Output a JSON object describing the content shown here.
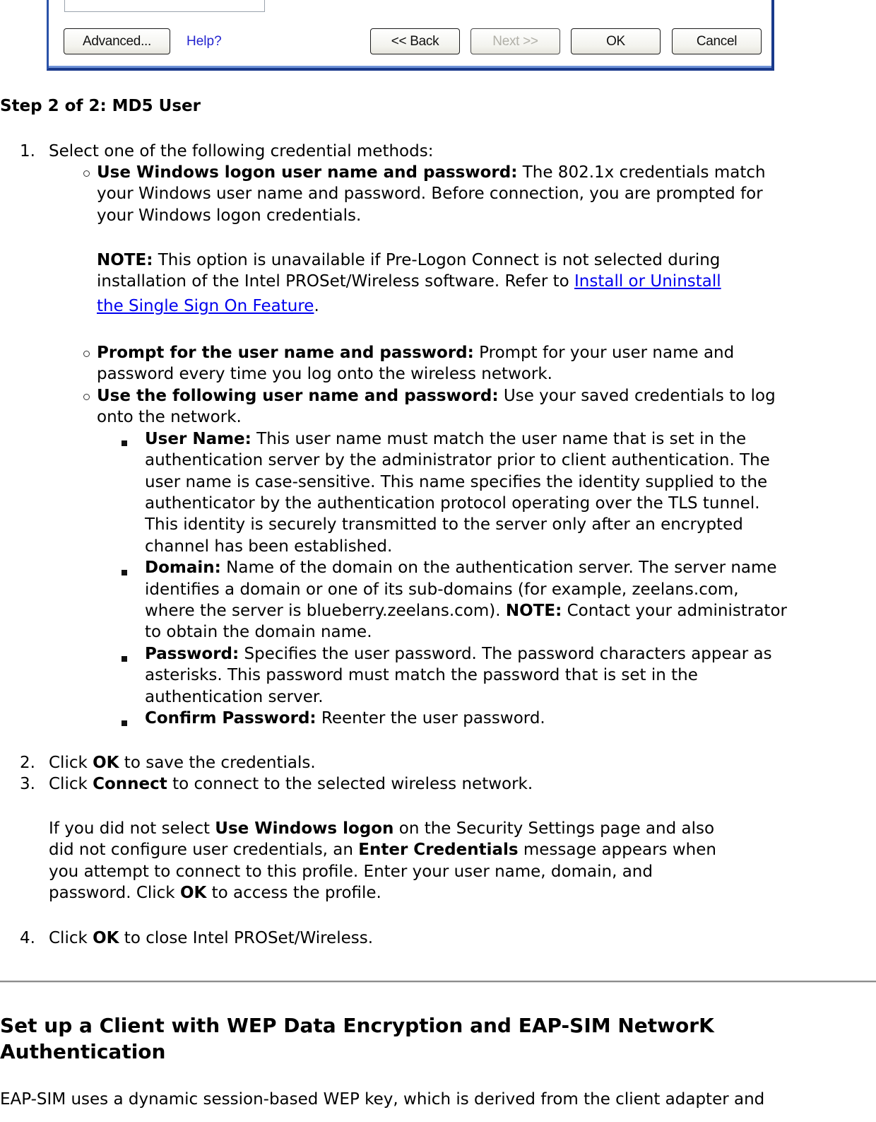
{
  "dialog": {
    "buttons": {
      "advanced": "Advanced...",
      "help": "Help?",
      "back": "<< Back",
      "next": "Next >>",
      "ok": "OK",
      "cancel": "Cancel"
    },
    "next_disabled": true
  },
  "step_heading": "Step 2 of 2: MD5 User",
  "steps": {
    "s1": {
      "number": "1.",
      "text": "Select one of the following credential methods:",
      "options": {
        "o1": {
          "label": "Use Windows logon user name and password:",
          "lines": [
            " The 802.1x credentials match",
            "your Windows user name and password. Before connection, you are prompted for",
            "your Windows logon credentials."
          ],
          "note_label": "NOTE:",
          "note_lines": [
            " This option is unavailable if Pre-Logon Connect is not selected during",
            "installation of the Intel PROSet/Wireless software. Refer to "
          ],
          "link_part1": "Install or Uninstall ",
          "link_part2": "the Single Sign On Feature",
          "link_suffix": "."
        },
        "o2": {
          "label": "Prompt for the user name and password:",
          "lines": [
            " Prompt for your user name and",
            "password every time you log onto the wireless network."
          ]
        },
        "o3": {
          "label": "Use the following user name and password:",
          "lines": [
            " Use your saved credentials to log",
            "onto the network."
          ],
          "fields": {
            "user_name": {
              "label": "User Name:",
              "lines": [
                " This user name must match the user name that is set in the",
                "authentication server by the administrator prior to client authentication. The",
                "user name is case-sensitive. This name specifies the identity supplied to the",
                "authenticator by the authentication protocol operating over the TLS tunnel.",
                "This identity is securely transmitted to the server only after an encrypted",
                "channel has been established."
              ]
            },
            "domain": {
              "label": "Domain:",
              "lines": [
                " Name of the domain on the authentication server. The server name",
                "identifies a domain or one of its sub-domains (for example, zeelans.com,",
                "where the server is blueberry.zeelans.com). ",
                "to obtain the domain name."
              ],
              "note_label": "NOTE:",
              "note_text": " Contact your administrator"
            },
            "password": {
              "label": "Password:",
              "lines": [
                " Specifies the user password. The password characters appear as",
                "asterisks. This password must match the password that is set in the",
                "authentication server."
              ]
            },
            "confirm_password": {
              "label": "Confirm Password:",
              "lines": [
                " Reenter the user password."
              ]
            }
          }
        }
      }
    },
    "s2": {
      "number": "2.",
      "pre": "Click ",
      "bold": "OK",
      "post": " to save the credentials."
    },
    "s3": {
      "number": "3.",
      "pre": "Click ",
      "bold": "Connect",
      "post": " to connect to the selected wireless network.",
      "note": {
        "l1_pre": "If you did not select ",
        "l1_bold": "Use Windows logon",
        "l1_post": " on the Security Settings page and also",
        "l2_pre": "did not configure user credentials, an ",
        "l2_bold": "Enter Credentials",
        "l2_post": " message appears when",
        "l3": "you attempt to connect to this profile. Enter your user name, domain, and",
        "l4_pre": "password. Click ",
        "l4_bold": "OK",
        "l4_post": " to access the profile."
      }
    },
    "s4": {
      "number": "4.",
      "pre": "Click ",
      "bold": "OK",
      "post": " to close Intel PROSet/Wireless."
    }
  },
  "section": {
    "title_l1": "Set up a Client with WEP Data Encryption and EAP-SIM NetworK",
    "title_l2": "Authentication",
    "intro": "EAP-SIM uses a dynamic session-based WEP key, which is derived from the client adapter and"
  }
}
